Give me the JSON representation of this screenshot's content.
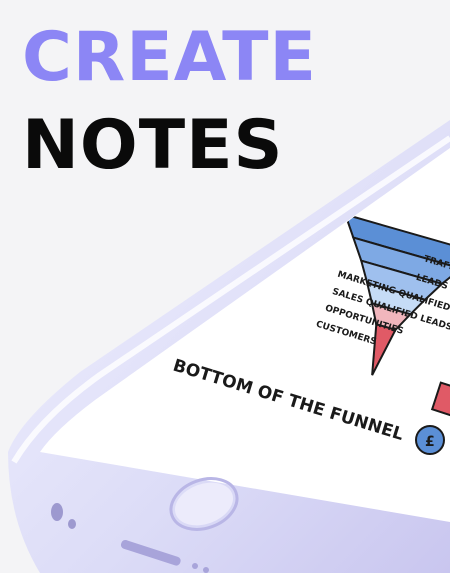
{
  "headline": {
    "line1": "CREATE",
    "line2": "NOTES"
  },
  "funnel": {
    "labels": [
      "TRAFFIC",
      "LEADS",
      "MARKETING QUALIFIED LEADS",
      "SALES QUALIFIED LEADS",
      "OPPORTUNITIES",
      "CUSTOMERS"
    ],
    "caption": "BOTTOM OF THE FUNNEL"
  },
  "colors": {
    "accent": "#8c86f5",
    "blue": "#5b8fd6",
    "red": "#e05a66",
    "phone_frame": "#e9e9fb"
  }
}
